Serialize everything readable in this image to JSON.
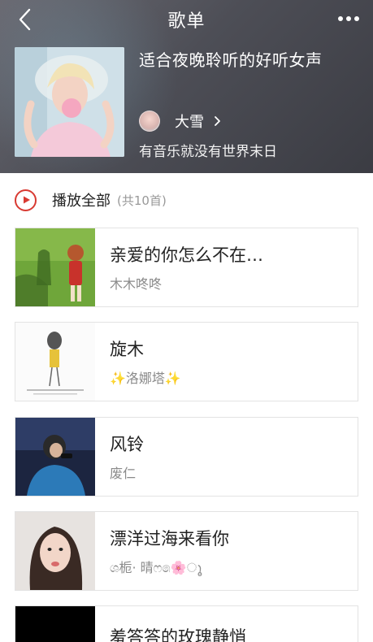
{
  "nav": {
    "title": "歌单"
  },
  "playlist": {
    "title": "适合夜晚聆听的好听女声",
    "creator_name": "大雪",
    "description": "有音乐就没有世界末日"
  },
  "play_all": {
    "label": "播放全部",
    "count": "(共10首)"
  },
  "songs": [
    {
      "title": "亲爱的你怎么不在…",
      "artist": "木木咚咚"
    },
    {
      "title": "旋木",
      "artist": "✨洛娜塔✨"
    },
    {
      "title": "风铃",
      "artist": "废仁"
    },
    {
      "title": "漂洋过海来看你",
      "artist": "ශ栀· 晴ෆ෧🌸ൂ"
    },
    {
      "title": "羞答答的玫瑰静悄"
    }
  ],
  "colors": {
    "accent": "#d83a32",
    "header_bg": "#4d4e56"
  },
  "icons": {
    "back": "chevron-left-icon",
    "more": "more-dots-icon",
    "play": "play-icon",
    "creator_chevron": "chevron-right-icon"
  }
}
